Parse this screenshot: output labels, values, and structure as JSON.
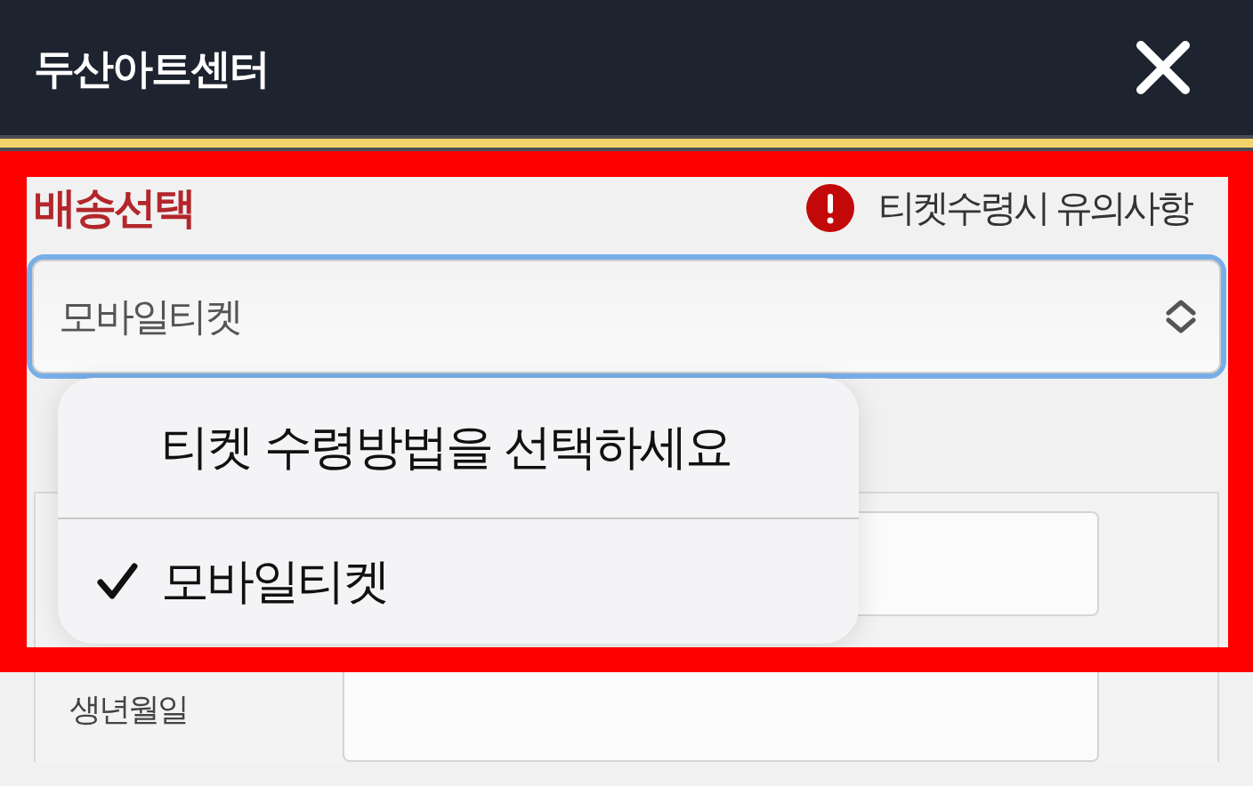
{
  "header": {
    "title": "두산아트센터"
  },
  "delivery": {
    "heading": "배송선택",
    "notice": "티켓수령시 유의사항",
    "select": {
      "value": "모바일티켓",
      "focused": true
    }
  },
  "form": {
    "rows": [
      {
        "kind": "text-input"
      },
      {
        "kind": "text-input",
        "label": "생년월일"
      }
    ]
  },
  "dropdown": {
    "options": [
      {
        "label": "티켓 수령방법을 선택하세요",
        "selected": false
      },
      {
        "label": "모바일티켓",
        "selected": true
      }
    ]
  },
  "annotation": {
    "highlight": true
  }
}
